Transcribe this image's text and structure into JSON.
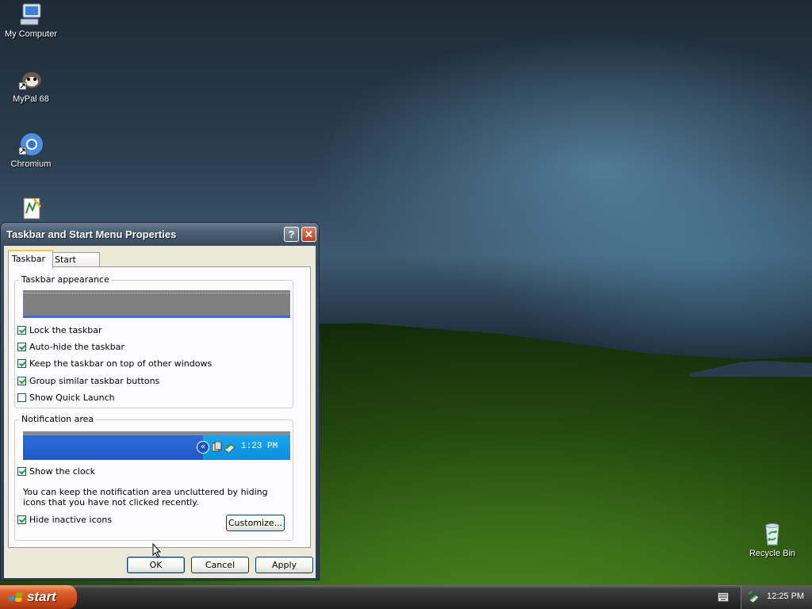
{
  "desktop": {
    "icons": [
      {
        "label": "My Computer"
      },
      {
        "label": "MyPal 68"
      },
      {
        "label": "Chromium"
      },
      {
        "label": ""
      },
      {
        "label": "Recycle Bin"
      }
    ]
  },
  "dialog": {
    "title": "Taskbar and Start Menu Properties",
    "help_glyph": "?",
    "close_glyph": "✕",
    "tabs": [
      {
        "label": "Taskbar",
        "active": true
      },
      {
        "label": "Start Menu",
        "active": false
      }
    ],
    "appearance_group": {
      "legend": "Taskbar appearance",
      "options": [
        {
          "label": "Lock the taskbar",
          "checked": true
        },
        {
          "label": "Auto-hide the taskbar",
          "checked": true
        },
        {
          "label": "Keep the taskbar on top of other windows",
          "checked": true
        },
        {
          "label": "Group similar taskbar buttons",
          "checked": true
        },
        {
          "label": "Show Quick Launch",
          "checked": false
        }
      ]
    },
    "notification_group": {
      "legend": "Notification area",
      "preview_time": "1:23 PM",
      "show_clock_label": "Show the clock",
      "show_clock_checked": true,
      "description": "You can keep the notification area uncluttered by hiding icons that you have not clicked recently.",
      "hide_inactive_label": "Hide inactive icons",
      "hide_inactive_checked": true,
      "customize_label": "Customize..."
    },
    "buttons": {
      "ok": "OK",
      "cancel": "Cancel",
      "apply": "Apply"
    }
  },
  "taskbar": {
    "start_label": "start",
    "clock": "12:25 PM"
  },
  "colors": {
    "accent_blue": "#1f58c8",
    "start_orange": "#c8461a",
    "check_green": "#21a121"
  }
}
